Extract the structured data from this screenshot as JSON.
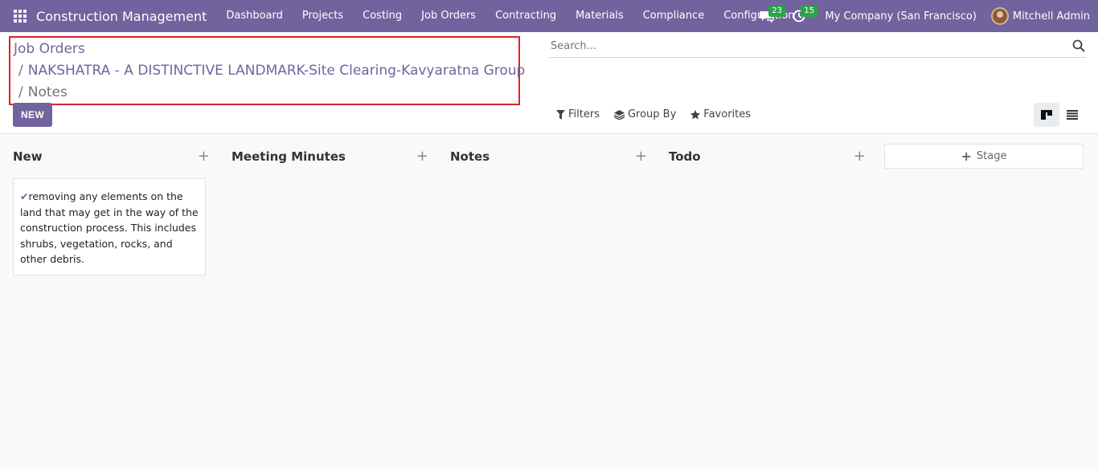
{
  "navbar": {
    "brand": "Construction Management",
    "menu": [
      "Dashboard",
      "Projects",
      "Costing",
      "Job Orders",
      "Contracting",
      "Materials",
      "Compliance",
      "Configuration"
    ],
    "messages_count": "23",
    "activities_count": "15",
    "company": "My Company (San Francisco)",
    "user": "Mitchell Admin",
    "badge_color": "#28a745",
    "bar_color": "#71639e"
  },
  "breadcrumb": {
    "items": [
      "Job Orders",
      "NAKSHATRA - A DISTINCTIVE LANDMARK-Site Clearing-Kavyaratna Group",
      "Notes"
    ],
    "separator": "/"
  },
  "new_button": "NEW",
  "search": {
    "placeholder": "Search..."
  },
  "filters": {
    "filters": "Filters",
    "group_by": "Group By",
    "favorites": "Favorites"
  },
  "kanban": {
    "columns": [
      {
        "title": "New",
        "cards": [
          {
            "text": "removing any elements on the land that may get in the way of the construction process. This includes shrubs, vegetation, rocks, and other debris."
          }
        ]
      },
      {
        "title": "Meeting Minutes",
        "cards": []
      },
      {
        "title": "Notes",
        "cards": []
      },
      {
        "title": "Todo",
        "cards": []
      }
    ],
    "add_stage_label": "Stage"
  },
  "highlight_color": "#d9232d"
}
